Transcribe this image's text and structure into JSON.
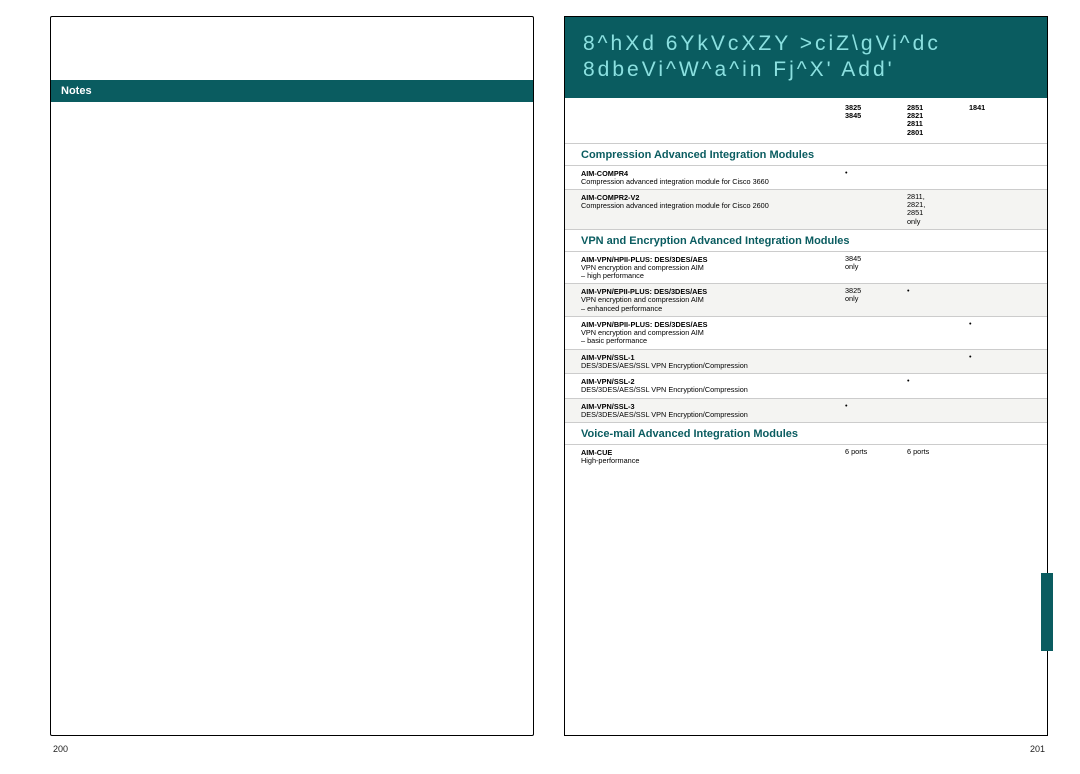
{
  "left": {
    "notes_label": "Notes",
    "page_number": "200"
  },
  "right": {
    "title_line1": "8^hXd 6YkVcXZY >ciZ\\gVi^dc",
    "title_line2": "8dbeVi^W^a^in Fj^X' Add'",
    "page_number": "201",
    "col_headers": {
      "c1": "3825\n3845",
      "c2": "2851\n2821\n2811\n2801",
      "c3": "1841"
    },
    "sections": [
      {
        "title": "Compression Advanced Integration Modules",
        "rows": [
          {
            "name": "AIM-COMPR4",
            "desc": "Compression advanced integration module for Cisco 3660",
            "c1": "•",
            "c2": "",
            "c3": "",
            "alt": false
          },
          {
            "name": "AIM-COMPR2-V2",
            "desc": "Compression advanced integration module for Cisco 2600",
            "c1": "",
            "c2": "2811,\n2821,\n2851\nonly",
            "c3": "",
            "alt": true
          }
        ]
      },
      {
        "title": "VPN and Encryption Advanced Integration Modules",
        "rows": [
          {
            "name": "AIM-VPN/HPII-PLUS: DES/3DES/AES",
            "desc": "VPN encryption and compression AIM\n– high performance",
            "c1": "3845\nonly",
            "c2": "",
            "c3": "",
            "alt": false
          },
          {
            "name": "AIM-VPN/EPII-PLUS: DES/3DES/AES",
            "desc": "VPN encryption and compression AIM\n– enhanced performance",
            "c1": "3825\nonly",
            "c2": "•",
            "c3": "",
            "alt": true
          },
          {
            "name": "AIM-VPN/BPII-PLUS: DES/3DES/AES",
            "desc": "VPN encryption and compression AIM\n– basic performance",
            "c1": "",
            "c2": "",
            "c3": "•",
            "alt": false
          },
          {
            "name": "AIM-VPN/SSL-1",
            "desc": "DES/3DES/AES/SSL VPN Encryption/Compression",
            "c1": "",
            "c2": "",
            "c3": "•",
            "alt": true
          },
          {
            "name": "AIM-VPN/SSL-2",
            "desc": "DES/3DES/AES/SSL VPN Encryption/Compression",
            "c1": "",
            "c2": "•",
            "c3": "",
            "alt": false
          },
          {
            "name": "AIM-VPN/SSL-3",
            "desc": "DES/3DES/AES/SSL VPN Encryption/Compression",
            "c1": "•",
            "c2": "",
            "c3": "",
            "alt": true
          }
        ]
      },
      {
        "title": "Voice-mail Advanced Integration Modules",
        "rows": [
          {
            "name": "AIM-CUE",
            "desc": "High-performance",
            "c1": "6 ports",
            "c2": "6 ports",
            "c3": "",
            "alt": false
          }
        ]
      }
    ]
  }
}
